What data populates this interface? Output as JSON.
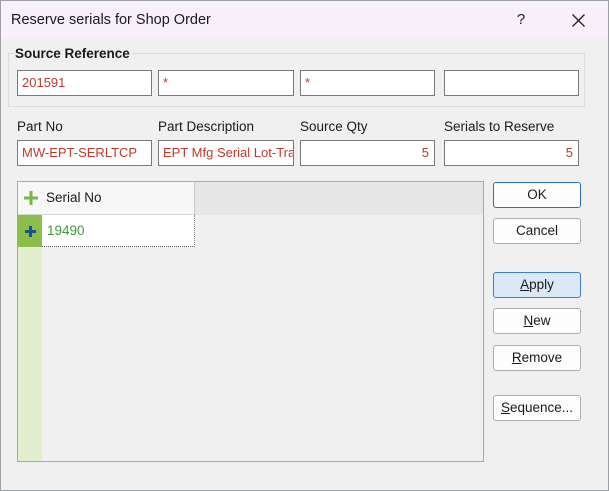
{
  "window": {
    "title": "Reserve serials for Shop Order",
    "help_label": "?"
  },
  "source_reference": {
    "label": "Source Reference",
    "fields": [
      "201591",
      "*",
      "*",
      ""
    ]
  },
  "details": {
    "part_no_label": "Part No",
    "part_no_value": "MW-EPT-SERLTCP",
    "part_description_label": "Part Description",
    "part_description_value": "EPT Mfg Serial Lot-Tra",
    "source_qty_label": "Source Qty",
    "source_qty_value": "5",
    "serials_to_reserve_label": "Serials to Reserve",
    "serials_to_reserve_value": "5"
  },
  "grid": {
    "column_header": "Serial No",
    "rows": [
      {
        "serial_no": "19490"
      }
    ]
  },
  "buttons": {
    "ok": "OK",
    "cancel": "Cancel",
    "apply_first": "A",
    "apply_rest": "pply",
    "new_first": "N",
    "new_rest": "ew",
    "remove_first": "R",
    "remove_rest": "emove",
    "sequence_first": "S",
    "sequence_rest": "equence..."
  },
  "colors": {
    "required_text": "#c1392b",
    "serial_text": "#3f9a3f",
    "row_marker": "#8dbd4a",
    "add_column": "#e3edcf"
  }
}
